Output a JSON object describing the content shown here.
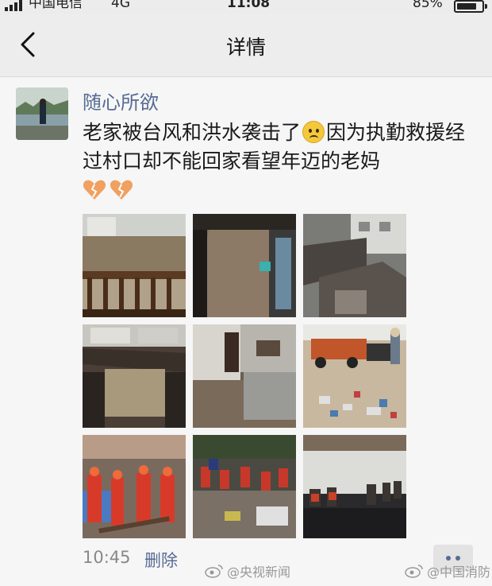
{
  "status_bar": {
    "carrier": "中国电信",
    "network": "4G",
    "time": "11:08",
    "battery": "85%"
  },
  "nav": {
    "title": "详情",
    "back_icon": "chevron-left-icon"
  },
  "post": {
    "username": "随心所欲",
    "text_part1": "老家被台风和洪水袭击了",
    "text_part2": "因为执勤救援经过村口却不能回家看望年迈的老妈",
    "emojis": [
      "sad-face-icon",
      "broken-heart-icon",
      "broken-heart-icon"
    ],
    "photo_count": 9,
    "time": "10:45",
    "delete_label": "删除"
  },
  "watermarks": [
    {
      "text": "@央视新闻",
      "icon": "weibo-icon"
    },
    {
      "text": "@中国消防",
      "icon": "weibo-icon"
    }
  ],
  "colors": {
    "link": "#576b95",
    "background": "#ececec",
    "card": "#f6f6f6",
    "text": "#1a1a1a",
    "muted": "#888888"
  }
}
